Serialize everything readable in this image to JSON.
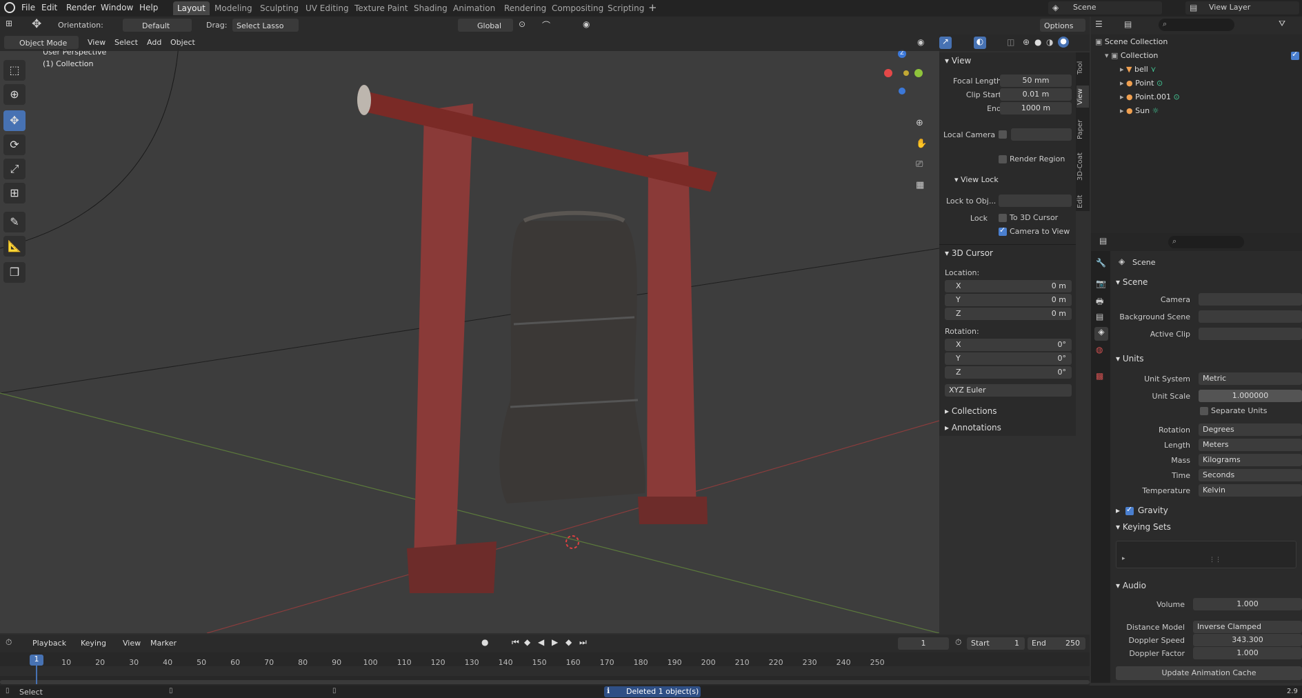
{
  "topbar": {
    "menus": [
      "File",
      "Edit",
      "Render",
      "Window",
      "Help"
    ],
    "workspaces": [
      "Layout",
      "Modeling",
      "Sculpting",
      "UV Editing",
      "Texture Paint",
      "Shading",
      "Animation",
      "Rendering",
      "Compositing",
      "Scripting"
    ],
    "active_workspace": "Layout",
    "scene": "Scene",
    "view_layer": "View Layer"
  },
  "toolheader": {
    "orientation_label": "Orientation:",
    "orientation_value": "Default",
    "drag_label": "Drag:",
    "drag_value": "Select Lasso",
    "transform_orientation": "Global",
    "options": "Options"
  },
  "viewport_header": {
    "mode": "Object Mode",
    "menus": [
      "View",
      "Select",
      "Add",
      "Object"
    ]
  },
  "viewport": {
    "perspective": "User Perspective",
    "collection": "(1) Collection",
    "axis_x": "X",
    "axis_y": "Y",
    "axis_z": "Z"
  },
  "npanel": {
    "view_header": "View",
    "focal_length_label": "Focal Length",
    "focal_length": "50 mm",
    "clip_start_label": "Clip Start",
    "clip_start": "0.01 m",
    "end_label": "End",
    "end": "1000 m",
    "local_camera_label": "Local Camera",
    "render_region_label": "Render Region",
    "view_lock_header": "View Lock",
    "lock_to_obj_label": "Lock to Obj...",
    "lock_label": "Lock",
    "to_3d_cursor_label": "To 3D Cursor",
    "camera_to_view_label": "Camera to View",
    "cursor_header": "3D Cursor",
    "location_label": "Location:",
    "loc_x_label": "X",
    "loc_x": "0 m",
    "loc_y_label": "Y",
    "loc_y": "0 m",
    "loc_z_label": "Z",
    "loc_z": "0 m",
    "rotation_label": "Rotation:",
    "rot_x_label": "X",
    "rot_x": "0°",
    "rot_y_label": "Y",
    "rot_y": "0°",
    "rot_z_label": "Z",
    "rot_z": "0°",
    "rotation_mode": "XYZ Euler",
    "collections_header": "Collections",
    "annotations_header": "Annotations",
    "tabs": [
      "Tool",
      "View",
      "Paper",
      "3D-Coat",
      "Edit"
    ]
  },
  "outliner": {
    "scene_collection": "Scene Collection",
    "collection": "Collection",
    "items": [
      "bell",
      "Point",
      "Point.001",
      "Sun"
    ]
  },
  "properties": {
    "breadcrumb": "Scene",
    "scene_header": "Scene",
    "camera_label": "Camera",
    "background_scene_label": "Background Scene",
    "active_clip_label": "Active Clip",
    "units_header": "Units",
    "unit_system_label": "Unit System",
    "unit_system": "Metric",
    "unit_scale_label": "Unit Scale",
    "unit_scale": "1.000000",
    "separate_units_label": "Separate Units",
    "rotation_label": "Rotation",
    "rotation": "Degrees",
    "length_label": "Length",
    "length": "Meters",
    "mass_label": "Mass",
    "mass": "Kilograms",
    "time_label": "Time",
    "time": "Seconds",
    "temperature_label": "Temperature",
    "temperature": "Kelvin",
    "gravity_header": "Gravity",
    "keying_sets_header": "Keying Sets",
    "audio_header": "Audio",
    "volume_label": "Volume",
    "volume": "1.000",
    "distance_model_label": "Distance Model",
    "distance_model": "Inverse Clamped",
    "doppler_speed_label": "Doppler Speed",
    "doppler_speed": "343.300",
    "doppler_factor_label": "Doppler Factor",
    "doppler_factor": "1.000",
    "update_cache": "Update Animation Cache"
  },
  "timeline": {
    "menus": [
      "Playback",
      "Keying",
      "View",
      "Marker"
    ],
    "current_frame": "1",
    "start_label": "Start",
    "start": "1",
    "end_label": "End",
    "end": "250",
    "ticks": [
      "10",
      "20",
      "30",
      "40",
      "50",
      "60",
      "70",
      "80",
      "90",
      "100",
      "110",
      "120",
      "130",
      "140",
      "150",
      "160",
      "170",
      "180",
      "190",
      "200",
      "210",
      "220",
      "230",
      "240",
      "250"
    ],
    "playhead": "1"
  },
  "statusbar": {
    "select": "Select",
    "message": "Deleted 1 object(s)",
    "version": "2.9"
  }
}
